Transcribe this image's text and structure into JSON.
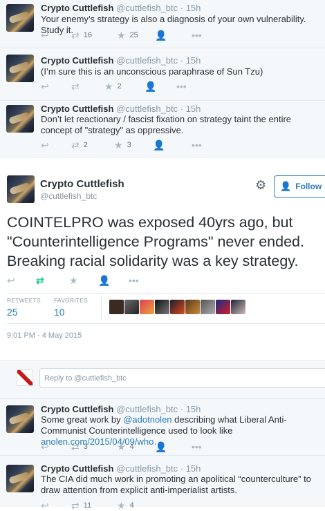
{
  "tweets_top": [
    {
      "name": "Crypto Cuttlefish",
      "handle": "@cuttlefish_btc · 15h",
      "text": "Your enemy’s strategy is also a diagnosis of your own vulnerability. Study it.",
      "retweets": "16",
      "favorites": "25"
    },
    {
      "name": "Crypto Cuttlefish",
      "handle": "@cuttlefish_btc · 15h",
      "text": "(I’m sure this is an unconscious paraphrase of Sun Tzu)",
      "retweets": "",
      "favorites": "2"
    },
    {
      "name": "Crypto Cuttlefish",
      "handle": "@cuttlefish_btc · 15h",
      "text": "Don’t let reactionary / fascist fixation on strategy taint the entire concept of \"strategy\" as oppressive.",
      "retweets": "2",
      "favorites": "3"
    }
  ],
  "main": {
    "name": "Crypto Cuttlefish",
    "handle": "@cuttlefish_btc",
    "follow_label": "Follow",
    "text_line1": "COINTELPRO was exposed 40yrs ago, but",
    "text_line2": "\"Counterintelligence Programs\" never ended.",
    "text_line3": "Breaking racial solidarity was a key strategy.",
    "retweets_label": "RETWEETS",
    "retweets": "25",
    "favorites_label": "FAVORITES",
    "favorites": "10",
    "timestamp": "9:01 PM - 4 May 2015"
  },
  "reply": {
    "placeholder": "Reply to @cuttlefish_btc"
  },
  "tweets_bottom": [
    {
      "name": "Crypto Cuttlefish",
      "handle": "@cuttlefish_btc · 15h",
      "text_pre": "Some great work by ",
      "mention": "@adotnolen",
      "text_mid": " describing what Liberal Anti-Communist Counterintelligence used to look like ",
      "url": "anolen.com/2015/04/09/who…",
      "retweets": "3",
      "favorites": "4"
    },
    {
      "name": "Crypto Cuttlefish",
      "handle": "@cuttlefish_btc · 15h",
      "text": "The CIA did much work in promoting an apolitical “counterculture” to draw attention from explicit anti-imperialist artists.",
      "retweets": "11",
      "favorites": "4"
    }
  ],
  "colors": {
    "accent": "#2b7bb9",
    "retweeted": "#19cf86",
    "muted": "#8899a6"
  }
}
